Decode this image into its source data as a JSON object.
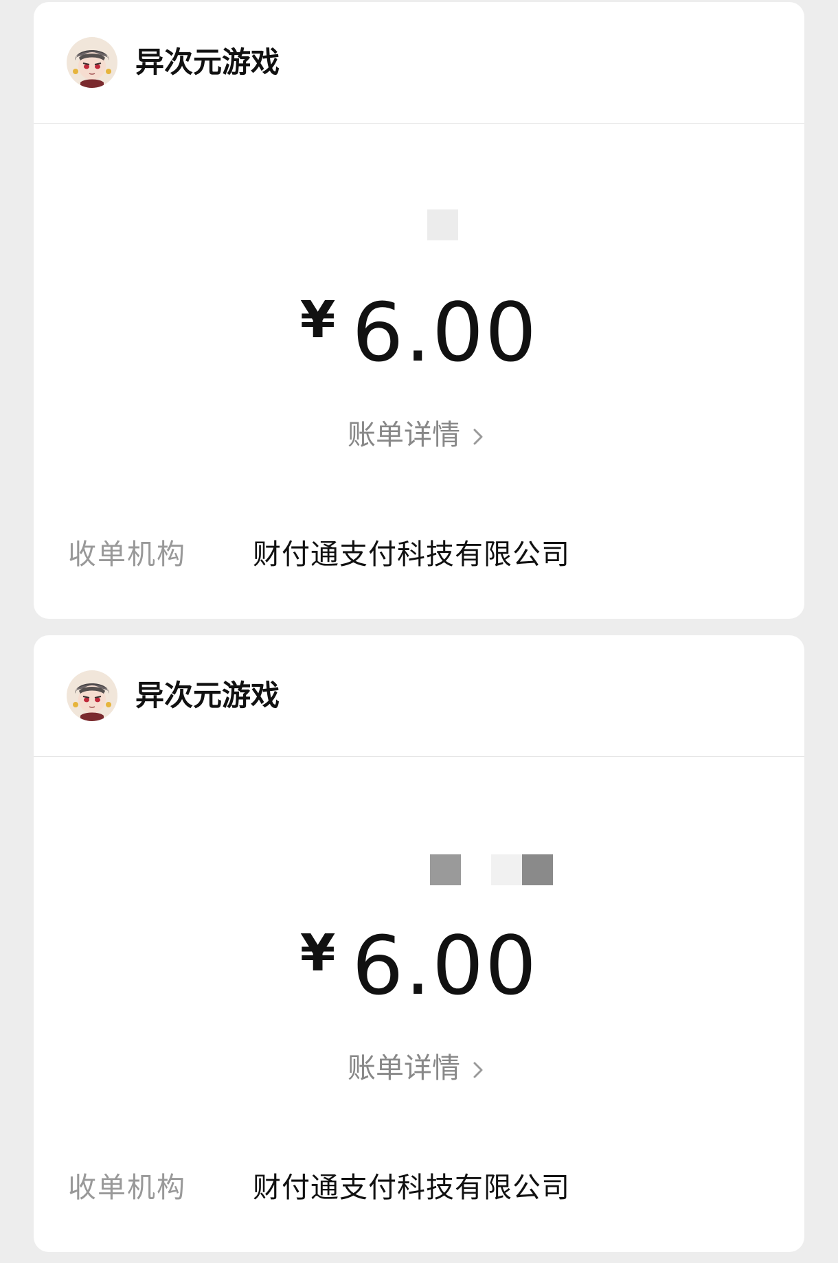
{
  "transactions": [
    {
      "merchant": {
        "name": "异次元游戏",
        "avatar_icon": "anime-character-avatar"
      },
      "amount": {
        "currency": "¥",
        "value": "6.00"
      },
      "bill_detail_label": "账单详情",
      "acquirer": {
        "label": "收单机构",
        "value": "财付通支付科技有限公司"
      }
    },
    {
      "merchant": {
        "name": "异次元游戏",
        "avatar_icon": "anime-character-avatar"
      },
      "amount": {
        "currency": "¥",
        "value": "6.00"
      },
      "bill_detail_label": "账单详情",
      "acquirer": {
        "label": "收单机构",
        "value": "财付通支付科技有限公司"
      }
    }
  ],
  "colors": {
    "background": "#ededed",
    "card": "#ffffff",
    "primary_text": "#111111",
    "secondary_text": "#999999",
    "link_text": "#888888"
  }
}
